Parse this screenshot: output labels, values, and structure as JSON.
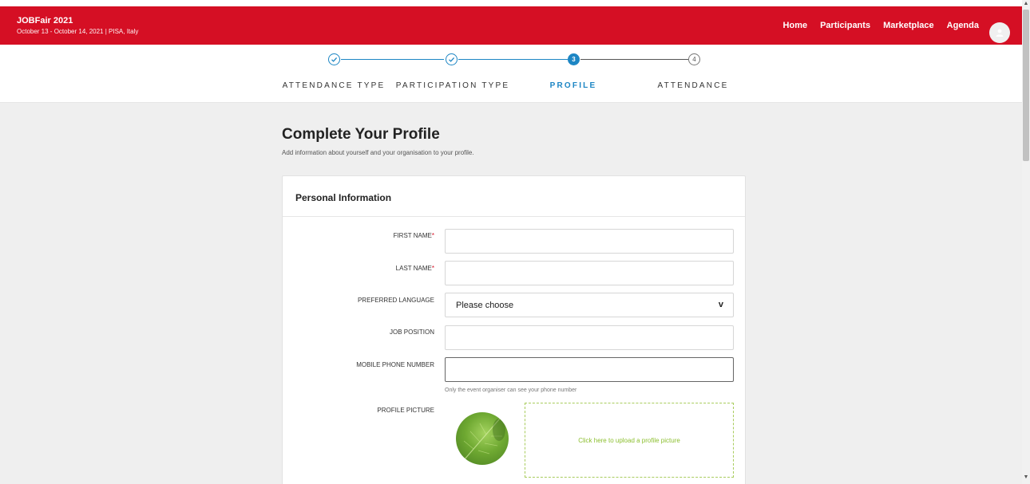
{
  "header": {
    "event_title": "JOBFair 2021",
    "event_subtitle": "October 13 - October 14, 2021 | PISA, Italy",
    "nav": [
      "Home",
      "Participants",
      "Marketplace",
      "Agenda"
    ],
    "brand_color": "#d50f24"
  },
  "stepper": {
    "accent_color": "#1d86c4",
    "steps": [
      {
        "number": "1",
        "label": "ATTENDANCE TYPE",
        "state": "done"
      },
      {
        "number": "2",
        "label": "PARTICIPATION TYPE",
        "state": "done"
      },
      {
        "number": "3",
        "label": "PROFILE",
        "state": "active"
      },
      {
        "number": "4",
        "label": "ATTENDANCE",
        "state": "todo"
      }
    ]
  },
  "page": {
    "title": "Complete Your Profile",
    "subtitle": "Add information about yourself and your organisation to your profile."
  },
  "form": {
    "section_title": "Personal Information",
    "first_name_label": "FIRST NAME",
    "last_name_label": "LAST NAME",
    "required_mark": "*",
    "preferred_language_label": "PREFERRED LANGUAGE",
    "preferred_language_value": "Please choose",
    "job_position_label": "JOB POSITION",
    "mobile_phone_label": "MOBILE PHONE NUMBER",
    "mobile_phone_hint": "Only the event organiser can see your phone number",
    "profile_picture_label": "PROFILE PICTURE",
    "upload_text": "Click here to upload a profile picture"
  }
}
